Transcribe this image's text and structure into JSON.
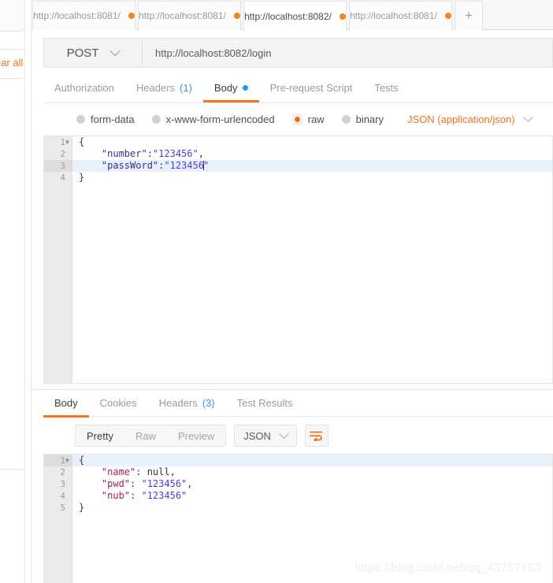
{
  "sidebar": {
    "clear_all_label": "ear all"
  },
  "tabstrip": {
    "tabs": [
      {
        "label": "http://localhost:8081/",
        "active": false,
        "unsaved": true
      },
      {
        "label": "http://localhost:8081/",
        "active": false,
        "unsaved": true
      },
      {
        "label": "http://localhost:8082/",
        "active": true,
        "unsaved": true
      },
      {
        "label": "http://localhost:8081/",
        "active": false,
        "unsaved": true
      }
    ],
    "add_tab_label": "+"
  },
  "urlbar": {
    "method": "POST",
    "url": "http://localhost:8082/login"
  },
  "request_tabs": [
    {
      "label": "Authorization",
      "active": false
    },
    {
      "label": "Headers",
      "count": "(1)",
      "active": false
    },
    {
      "label": "Body",
      "active": true,
      "dot": true
    },
    {
      "label": "Pre-request Script",
      "active": false
    },
    {
      "label": "Tests",
      "active": false
    }
  ],
  "body_type": {
    "options": [
      {
        "label": "form-data",
        "selected": false
      },
      {
        "label": "x-www-form-urlencoded",
        "selected": false
      },
      {
        "label": "raw",
        "selected": true
      },
      {
        "label": "binary",
        "selected": false
      }
    ],
    "format": "JSON (application/json)"
  },
  "request_body": {
    "lines": [
      {
        "num": "1",
        "fold": true,
        "highlight": false,
        "tokens": [
          {
            "t": "{",
            "c": "punc"
          }
        ]
      },
      {
        "num": "2",
        "fold": false,
        "highlight": false,
        "tokens": [
          {
            "t": "    \"number\"",
            "c": "key-req"
          },
          {
            "t": ":",
            "c": "punc"
          },
          {
            "t": "\"123456\"",
            "c": "str"
          },
          {
            "t": ",",
            "c": "punc"
          }
        ]
      },
      {
        "num": "3",
        "fold": false,
        "highlight": true,
        "tokens": [
          {
            "t": "    \"passWord\"",
            "c": "key-req"
          },
          {
            "t": ":",
            "c": "punc"
          },
          {
            "t": "\"123456",
            "c": "str"
          },
          {
            "t": "CARET",
            "c": "caret"
          },
          {
            "t": "\"",
            "c": "str"
          }
        ]
      },
      {
        "num": "4",
        "fold": false,
        "highlight": false,
        "tokens": [
          {
            "t": "}",
            "c": "punc"
          }
        ]
      }
    ]
  },
  "response_tabs": [
    {
      "label": "Body",
      "active": true
    },
    {
      "label": "Cookies",
      "active": false
    },
    {
      "label": "Headers",
      "count": "(3)",
      "active": false
    },
    {
      "label": "Test Results",
      "active": false
    }
  ],
  "response_toolbar": {
    "views": [
      {
        "label": "Pretty",
        "active": true
      },
      {
        "label": "Raw",
        "active": false
      },
      {
        "label": "Preview",
        "active": false
      }
    ],
    "format": "JSON",
    "wrap_icon": "wrap-lines-icon"
  },
  "response_body": {
    "lines": [
      {
        "num": "1",
        "fold": true,
        "highlight": true,
        "tokens": [
          {
            "t": "{",
            "c": "punc"
          }
        ]
      },
      {
        "num": "2",
        "fold": false,
        "highlight": false,
        "tokens": [
          {
            "t": "    \"name\"",
            "c": "key-res"
          },
          {
            "t": ": ",
            "c": "punc"
          },
          {
            "t": "null",
            "c": "null"
          },
          {
            "t": ",",
            "c": "punc"
          }
        ]
      },
      {
        "num": "3",
        "fold": false,
        "highlight": false,
        "tokens": [
          {
            "t": "    \"pwd\"",
            "c": "key-res"
          },
          {
            "t": ": ",
            "c": "punc"
          },
          {
            "t": "\"123456\"",
            "c": "str"
          },
          {
            "t": ",",
            "c": "punc"
          }
        ]
      },
      {
        "num": "4",
        "fold": false,
        "highlight": false,
        "tokens": [
          {
            "t": "    \"nub\"",
            "c": "key-res"
          },
          {
            "t": ": ",
            "c": "punc"
          },
          {
            "t": "\"123456\"",
            "c": "str"
          }
        ]
      },
      {
        "num": "5",
        "fold": false,
        "highlight": false,
        "tokens": [
          {
            "t": "}",
            "c": "punc"
          }
        ]
      }
    ]
  },
  "watermark": {
    "text": "https://blog.csdn.net/qq_43757153"
  },
  "colors": {
    "accent_orange": "#f37321",
    "link_blue": "#4a90d9",
    "dot_blue": "#1c9fe4",
    "key_request": "#3a2d8c",
    "key_response": "#9c2161",
    "string_value": "#4b3ddb",
    "active_line": "#e8f1fb"
  }
}
